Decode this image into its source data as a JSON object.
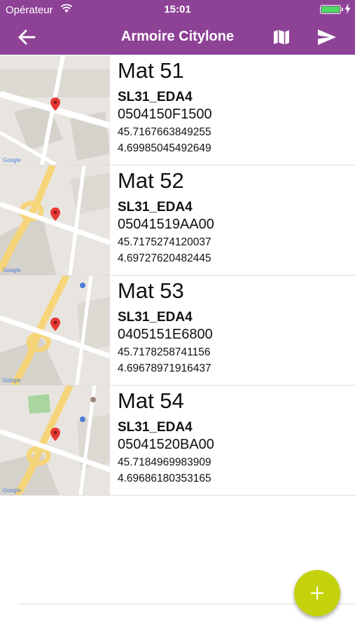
{
  "status_bar": {
    "carrier": "Opérateur",
    "time": "15:01",
    "battery_level_pct": 100
  },
  "app_bar": {
    "title": "Armoire Citylone",
    "back_icon": "arrow-left-icon",
    "map_icon": "map-icon",
    "send_icon": "send-icon"
  },
  "items": [
    {
      "name": "Mat 51",
      "type": "SL31_EDA4",
      "code": "0504150F1500",
      "lat": "45.7167663849255",
      "lng": "4.69985045492649"
    },
    {
      "name": "Mat 52",
      "type": "SL31_EDA4",
      "code": "05041519AA00",
      "lat": "45.7175274120037",
      "lng": "4.69727620482445"
    },
    {
      "name": "Mat 53",
      "type": "SL31_EDA4",
      "code": "0405151E6800",
      "lat": "45.7178258741156",
      "lng": "4.69678971916437"
    },
    {
      "name": "Mat 54",
      "type": "SL31_EDA4",
      "code": "05041520BA00",
      "lat": "45.7184969983909",
      "lng": "4.69686180353165"
    }
  ],
  "fab": {
    "icon": "plus-icon"
  },
  "colors": {
    "primary": "#8e4296",
    "accent": "#c4d20c"
  }
}
